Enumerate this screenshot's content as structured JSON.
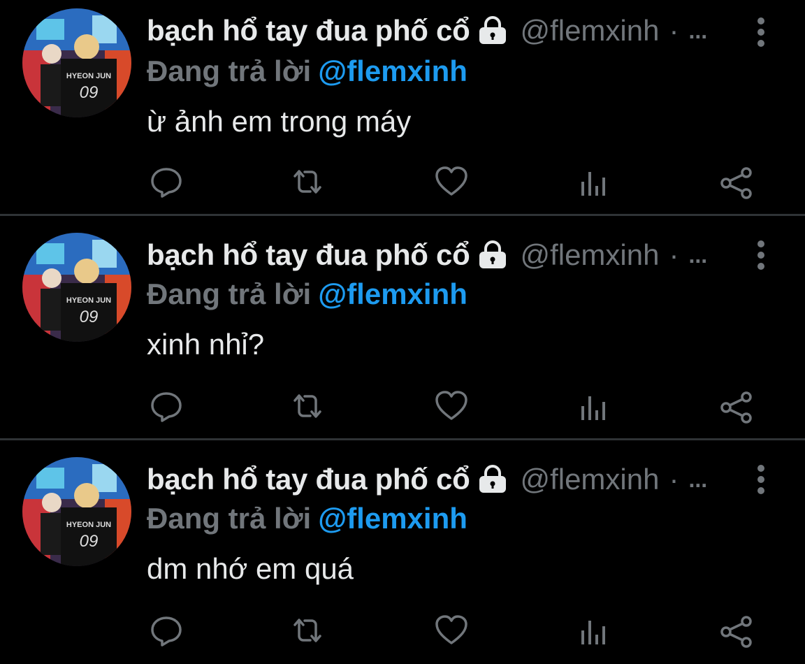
{
  "tweets": [
    {
      "author_name": "bạch hổ tay đua phố cổ",
      "handle": "@flemxinh",
      "separator": "·",
      "time_truncated": "...",
      "reply_prefix": "Đang trả lời",
      "reply_mention": "@flemxinh",
      "text": "ừ ảnh em trong máy"
    },
    {
      "author_name": "bạch hổ tay đua phố cổ",
      "handle": "@flemxinh",
      "separator": "·",
      "time_truncated": "...",
      "reply_prefix": "Đang trả lời",
      "reply_mention": "@flemxinh",
      "text": "xinh nhỉ?"
    },
    {
      "author_name": "bạch hổ tay đua phố cổ",
      "handle": "@flemxinh",
      "separator": "·",
      "time_truncated": "...",
      "reply_prefix": "Đang trả lời",
      "reply_mention": "@flemxinh",
      "text": "dm nhớ em quá"
    }
  ],
  "avatar": {
    "jersey_name": "HYEON JUN",
    "jersey_number": "09"
  },
  "icons": {
    "lock": "lock-icon",
    "more": "more-vertical-icon",
    "reply": "reply-icon",
    "retweet": "retweet-icon",
    "like": "heart-icon",
    "views": "views-icon",
    "share": "share-icon"
  },
  "colors": {
    "background": "#000000",
    "text": "#e7e9ea",
    "muted": "#71767b",
    "mention": "#1d9bf0",
    "divider": "#2f3336"
  }
}
